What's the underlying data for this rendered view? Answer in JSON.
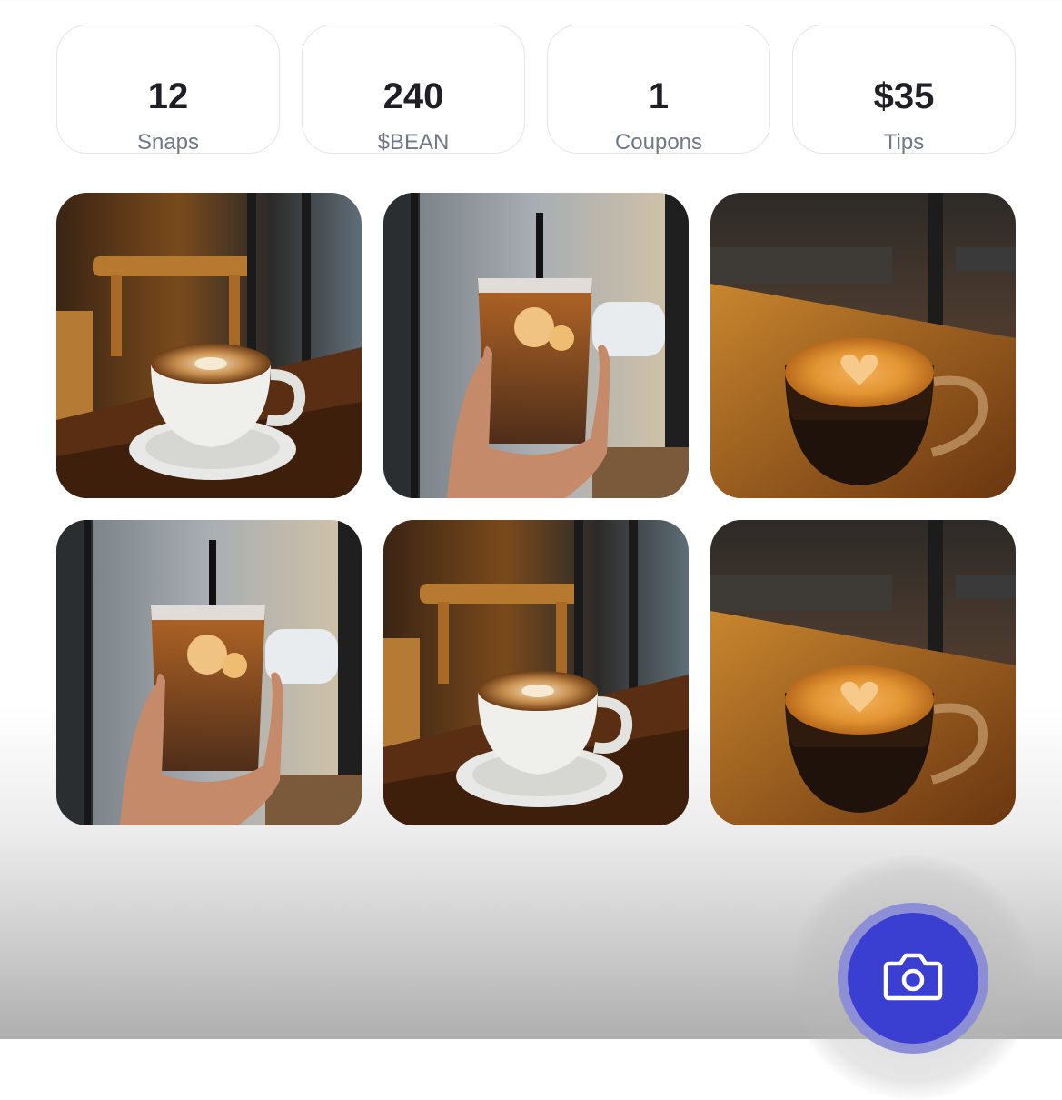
{
  "stats": [
    {
      "value": "12",
      "label": "Snaps"
    },
    {
      "value": "240",
      "label": "$BEAN"
    },
    {
      "value": "1",
      "label": "Coupons"
    },
    {
      "value": "$35",
      "label": "Tips"
    }
  ],
  "gallery": [
    {
      "subject": "latte-cup-on-saucer"
    },
    {
      "subject": "iced-coffee-in-hand"
    },
    {
      "subject": "espresso-glass-cup"
    },
    {
      "subject": "iced-coffee-in-hand"
    },
    {
      "subject": "latte-cup-on-saucer"
    },
    {
      "subject": "espresso-glass-cup"
    }
  ],
  "camera_button": {
    "icon": "camera-icon"
  },
  "colors": {
    "accent": "#3b3fd1",
    "accent_ring": "#8c8fd6",
    "stat_value": "#1f1f25",
    "stat_label": "#707787",
    "card_border": "#e4e4e7"
  }
}
